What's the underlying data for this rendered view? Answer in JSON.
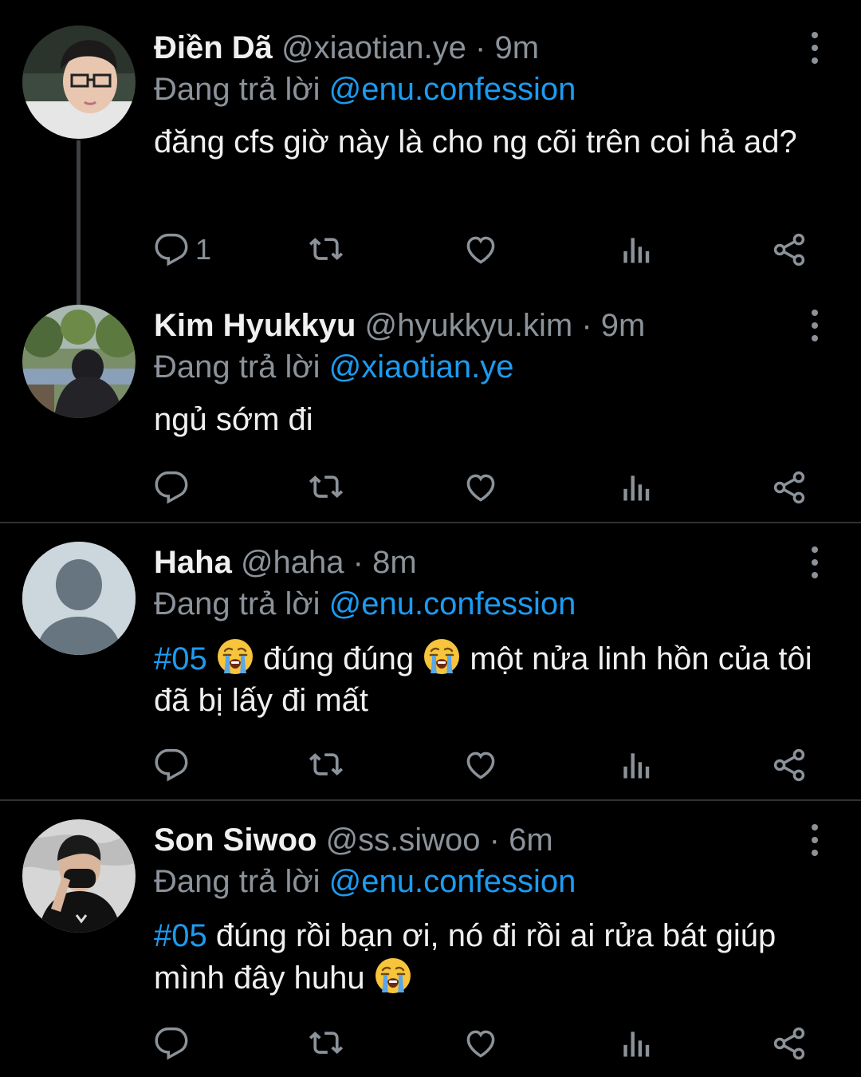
{
  "tweets": [
    {
      "name": "Điền Dã",
      "handle": "@xiaotian.ye",
      "sep": " · ",
      "time": "9m",
      "replying_prefix": "Đang trả lời ",
      "replying_to": "@enu.confession",
      "text": "đăng cfs giờ này là cho ng cõi trên coi hả ad?",
      "reply_count": "1"
    },
    {
      "name": "Kim Hyukkyu",
      "handle": "@hyukkyu.kim",
      "sep": " · ",
      "time": "9m",
      "replying_prefix": "Đang trả lời ",
      "replying_to": "@xiaotian.ye",
      "text": "ngủ sớm đi",
      "reply_count": ""
    },
    {
      "name": "Haha",
      "handle": "@haha",
      "sep": " · ",
      "time": "8m",
      "replying_prefix": "Đang trả lời ",
      "replying_to": "@enu.confession",
      "hashtag": "#05",
      "text_a": "đúng đúng",
      "text_b": "một nửa linh hồn của tôi đã bị lấy đi mất",
      "reply_count": ""
    },
    {
      "name": "Son Siwoo",
      "handle": "@ss.siwoo",
      "sep": " · ",
      "time": "6m",
      "replying_prefix": "Đang trả lời ",
      "replying_to": "@enu.confession",
      "hashtag": "#05",
      "text_a": "đúng rồi bạn ơi, nó đi rồi ai rửa bát giúp mình đây huhu",
      "reply_count": ""
    }
  ],
  "icons": {
    "reply": "reply-icon",
    "retweet": "retweet-icon",
    "like": "heart-icon",
    "views": "views-icon",
    "share": "share-icon",
    "more": "more-vertical-icon",
    "emoji": "loudly-crying-face-emoji"
  },
  "colors": {
    "background": "#000000",
    "text": "#f0f0f0",
    "muted": "#8b9299",
    "link": "#1d9bf0",
    "divider": "#2f3336"
  }
}
